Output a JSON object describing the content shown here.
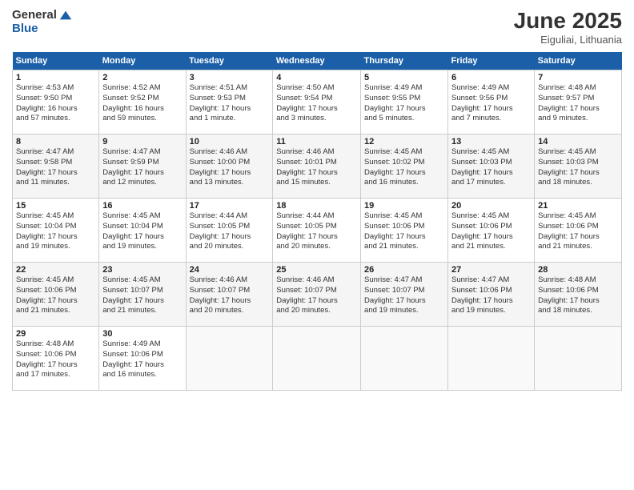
{
  "logo": {
    "general": "General",
    "blue": "Blue"
  },
  "title": "June 2025",
  "location": "Eiguliai, Lithuania",
  "days_of_week": [
    "Sunday",
    "Monday",
    "Tuesday",
    "Wednesday",
    "Thursday",
    "Friday",
    "Saturday"
  ],
  "weeks": [
    [
      {
        "num": "1",
        "info": "Sunrise: 4:53 AM\nSunset: 9:50 PM\nDaylight: 16 hours\nand 57 minutes."
      },
      {
        "num": "2",
        "info": "Sunrise: 4:52 AM\nSunset: 9:52 PM\nDaylight: 16 hours\nand 59 minutes."
      },
      {
        "num": "3",
        "info": "Sunrise: 4:51 AM\nSunset: 9:53 PM\nDaylight: 17 hours\nand 1 minute."
      },
      {
        "num": "4",
        "info": "Sunrise: 4:50 AM\nSunset: 9:54 PM\nDaylight: 17 hours\nand 3 minutes."
      },
      {
        "num": "5",
        "info": "Sunrise: 4:49 AM\nSunset: 9:55 PM\nDaylight: 17 hours\nand 5 minutes."
      },
      {
        "num": "6",
        "info": "Sunrise: 4:49 AM\nSunset: 9:56 PM\nDaylight: 17 hours\nand 7 minutes."
      },
      {
        "num": "7",
        "info": "Sunrise: 4:48 AM\nSunset: 9:57 PM\nDaylight: 17 hours\nand 9 minutes."
      }
    ],
    [
      {
        "num": "8",
        "info": "Sunrise: 4:47 AM\nSunset: 9:58 PM\nDaylight: 17 hours\nand 11 minutes."
      },
      {
        "num": "9",
        "info": "Sunrise: 4:47 AM\nSunset: 9:59 PM\nDaylight: 17 hours\nand 12 minutes."
      },
      {
        "num": "10",
        "info": "Sunrise: 4:46 AM\nSunset: 10:00 PM\nDaylight: 17 hours\nand 13 minutes."
      },
      {
        "num": "11",
        "info": "Sunrise: 4:46 AM\nSunset: 10:01 PM\nDaylight: 17 hours\nand 15 minutes."
      },
      {
        "num": "12",
        "info": "Sunrise: 4:45 AM\nSunset: 10:02 PM\nDaylight: 17 hours\nand 16 minutes."
      },
      {
        "num": "13",
        "info": "Sunrise: 4:45 AM\nSunset: 10:03 PM\nDaylight: 17 hours\nand 17 minutes."
      },
      {
        "num": "14",
        "info": "Sunrise: 4:45 AM\nSunset: 10:03 PM\nDaylight: 17 hours\nand 18 minutes."
      }
    ],
    [
      {
        "num": "15",
        "info": "Sunrise: 4:45 AM\nSunset: 10:04 PM\nDaylight: 17 hours\nand 19 minutes."
      },
      {
        "num": "16",
        "info": "Sunrise: 4:45 AM\nSunset: 10:04 PM\nDaylight: 17 hours\nand 19 minutes."
      },
      {
        "num": "17",
        "info": "Sunrise: 4:44 AM\nSunset: 10:05 PM\nDaylight: 17 hours\nand 20 minutes."
      },
      {
        "num": "18",
        "info": "Sunrise: 4:44 AM\nSunset: 10:05 PM\nDaylight: 17 hours\nand 20 minutes."
      },
      {
        "num": "19",
        "info": "Sunrise: 4:45 AM\nSunset: 10:06 PM\nDaylight: 17 hours\nand 21 minutes."
      },
      {
        "num": "20",
        "info": "Sunrise: 4:45 AM\nSunset: 10:06 PM\nDaylight: 17 hours\nand 21 minutes."
      },
      {
        "num": "21",
        "info": "Sunrise: 4:45 AM\nSunset: 10:06 PM\nDaylight: 17 hours\nand 21 minutes."
      }
    ],
    [
      {
        "num": "22",
        "info": "Sunrise: 4:45 AM\nSunset: 10:06 PM\nDaylight: 17 hours\nand 21 minutes."
      },
      {
        "num": "23",
        "info": "Sunrise: 4:45 AM\nSunset: 10:07 PM\nDaylight: 17 hours\nand 21 minutes."
      },
      {
        "num": "24",
        "info": "Sunrise: 4:46 AM\nSunset: 10:07 PM\nDaylight: 17 hours\nand 20 minutes."
      },
      {
        "num": "25",
        "info": "Sunrise: 4:46 AM\nSunset: 10:07 PM\nDaylight: 17 hours\nand 20 minutes."
      },
      {
        "num": "26",
        "info": "Sunrise: 4:47 AM\nSunset: 10:07 PM\nDaylight: 17 hours\nand 19 minutes."
      },
      {
        "num": "27",
        "info": "Sunrise: 4:47 AM\nSunset: 10:06 PM\nDaylight: 17 hours\nand 19 minutes."
      },
      {
        "num": "28",
        "info": "Sunrise: 4:48 AM\nSunset: 10:06 PM\nDaylight: 17 hours\nand 18 minutes."
      }
    ],
    [
      {
        "num": "29",
        "info": "Sunrise: 4:48 AM\nSunset: 10:06 PM\nDaylight: 17 hours\nand 17 minutes."
      },
      {
        "num": "30",
        "info": "Sunrise: 4:49 AM\nSunset: 10:06 PM\nDaylight: 17 hours\nand 16 minutes."
      },
      {
        "num": "",
        "info": ""
      },
      {
        "num": "",
        "info": ""
      },
      {
        "num": "",
        "info": ""
      },
      {
        "num": "",
        "info": ""
      },
      {
        "num": "",
        "info": ""
      }
    ]
  ]
}
